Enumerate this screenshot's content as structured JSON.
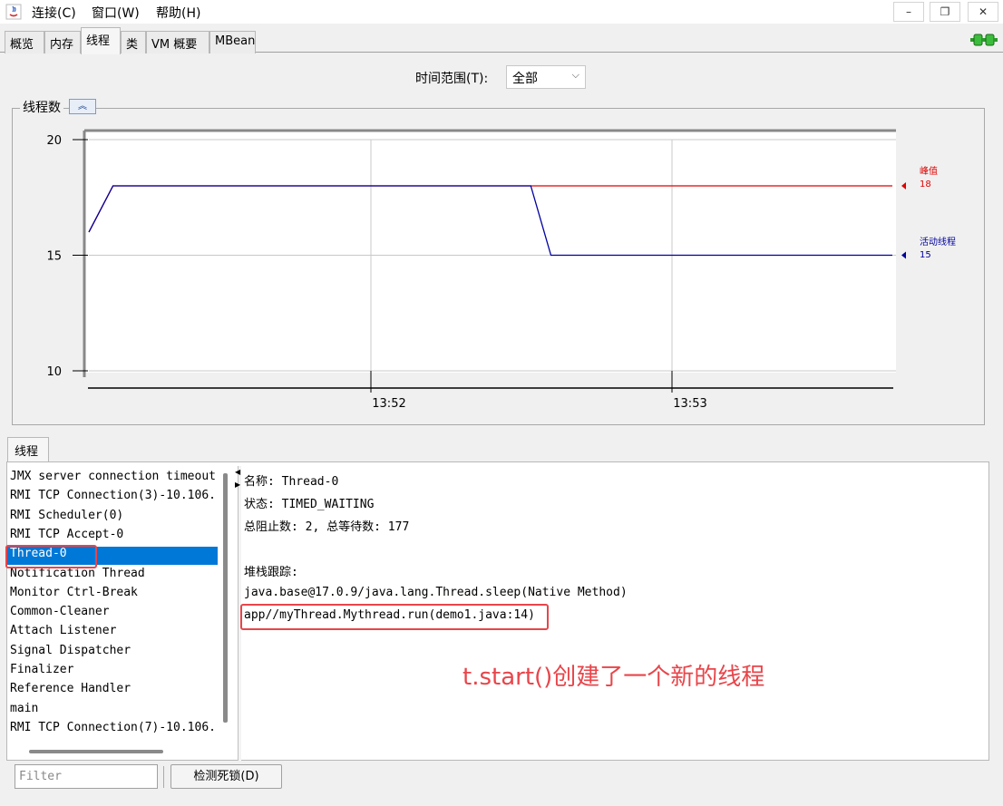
{
  "menubar": {
    "items": [
      "连接(C)",
      "窗口(W)",
      "帮助(H)"
    ],
    "win_min": "–",
    "win_restore": "❐",
    "win_close": "✕"
  },
  "tabs": [
    {
      "label": "概览",
      "active": false
    },
    {
      "label": "内存",
      "active": false
    },
    {
      "label": "线程",
      "active": true
    },
    {
      "label": "类",
      "active": false
    },
    {
      "label": "VM 概要",
      "active": false
    },
    {
      "label": "MBean",
      "active": false
    }
  ],
  "time_range": {
    "label": "时间范围(T):",
    "value": "全部"
  },
  "chart": {
    "title": "线程数",
    "collapse_symbol": "︽"
  },
  "chart_data": {
    "type": "line",
    "title": "线程数",
    "xlabel": "",
    "ylabel": "",
    "ylim": [
      10,
      20
    ],
    "yticks": [
      10,
      15,
      20
    ],
    "xticks": [
      "13:52",
      "13:53"
    ],
    "grid": true,
    "legend_position": "right",
    "series": [
      {
        "name": "峰值",
        "value_label": "18",
        "color": "#e00000",
        "points": [
          [
            0.0,
            16
          ],
          [
            0.03,
            18
          ],
          [
            1.0,
            18
          ]
        ]
      },
      {
        "name": "活动线程",
        "value_label": "15",
        "color": "#0000a0",
        "points": [
          [
            0.0,
            16
          ],
          [
            0.03,
            18
          ],
          [
            0.55,
            18
          ],
          [
            0.575,
            15
          ],
          [
            1.0,
            15
          ]
        ]
      }
    ]
  },
  "threads": {
    "tab_label": "线程",
    "list": [
      "JMX server connection timeout",
      "RMI TCP Connection(3)-10.106.",
      "RMI Scheduler(0)",
      "RMI TCP Accept-0",
      "Thread-0",
      "Notification Thread",
      "Monitor Ctrl-Break",
      "Common-Cleaner",
      "Attach Listener",
      "Signal Dispatcher",
      "Finalizer",
      "Reference Handler",
      "main",
      "RMI TCP Connection(7)-10.106."
    ],
    "selected_index": 4,
    "details": {
      "name": "名称: Thread-0",
      "state": "状态: TIMED_WAITING",
      "counts": "总阻止数: 2, 总等待数: 177",
      "stack_header": "堆栈跟踪:",
      "stack": [
        "java.base@17.0.9/java.lang.Thread.sleep(Native Method)",
        "app//myThread.Mythread.run(demo1.java:14)"
      ]
    },
    "annotation": "t.start()创建了一个新的线程",
    "filter_placeholder": "Filter",
    "deadlock_button": "检测死锁(D)"
  }
}
